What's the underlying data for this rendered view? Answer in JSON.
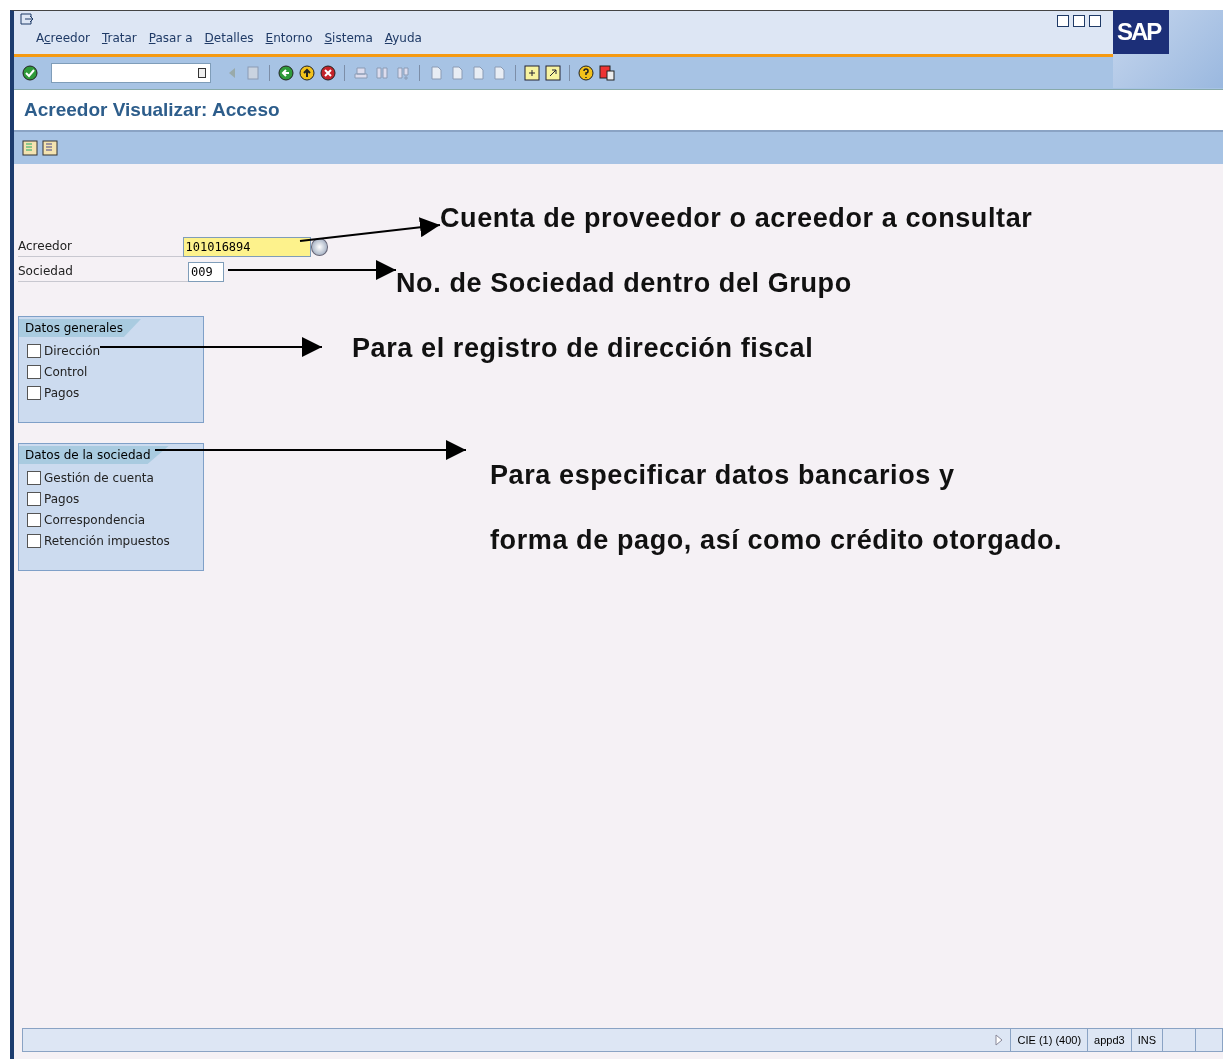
{
  "menu": [
    {
      "before": "A",
      "access_key": "c",
      "after": "reedor"
    },
    {
      "access_key": "T",
      "after": "ratar"
    },
    {
      "access_key": "P",
      "after": "asar a"
    },
    {
      "access_key": "D",
      "after": "etalles"
    },
    {
      "access_key": "E",
      "after": "ntorno"
    },
    {
      "access_key": "S",
      "after": "istema"
    },
    {
      "access_key": "A",
      "after": "yuda"
    }
  ],
  "logo": "SAP",
  "screen_title": "Acreedor Visualizar: Acceso",
  "fields": [
    {
      "label": "Acreedor",
      "value": "101016894",
      "kind": "required"
    },
    {
      "label": "Sociedad",
      "value": "009",
      "kind": "plain"
    }
  ],
  "groups": [
    {
      "title": "Datos generales",
      "items": [
        {
          "label": "Dirección",
          "checked": false
        },
        {
          "label": "Control",
          "checked": false
        },
        {
          "label": "Pagos",
          "checked": false
        }
      ]
    },
    {
      "title": "Datos de la sociedad",
      "items": [
        {
          "label": "Gestión de cuenta",
          "checked": false
        },
        {
          "label": "Pagos",
          "checked": false
        },
        {
          "label": "Correspondencia",
          "checked": false
        },
        {
          "label": "Retención impuestos",
          "checked": false
        }
      ]
    }
  ],
  "annotations": [
    "Cuenta de proveedor o acreedor a consultar",
    "No. de Sociedad dentro del Grupo",
    "Para el registro de dirección fiscal",
    "Para especificar datos bancarios y",
    "forma de pago, así como crédito otorgado."
  ],
  "status_bar": [
    "CIE (1) (400)",
    "appd3",
    "INS"
  ]
}
